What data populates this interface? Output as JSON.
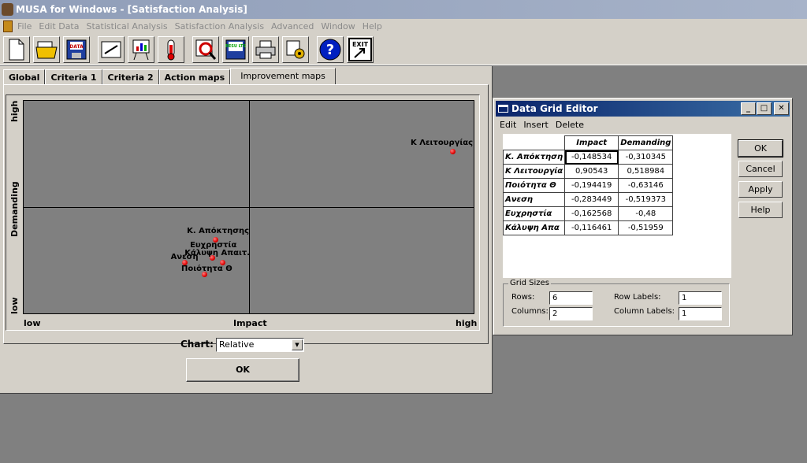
{
  "app": {
    "title": "MUSA for Windows - [Satisfaction Analysis]"
  },
  "menu": [
    "File",
    "Edit Data",
    "Statistical Analysis",
    "Satisfaction Analysis",
    "Advanced",
    "Window",
    "Help"
  ],
  "toolbar": {
    "data_label": "DATA",
    "results_label": "RESU LTS",
    "exit_label": "EXIT"
  },
  "tabs": [
    "Global",
    "Criteria 1",
    "Criteria 2",
    "Action maps",
    "Improvement maps"
  ],
  "chart": {
    "ylabel": "Demanding",
    "y_low": "low",
    "y_high": "high",
    "xlabel": "Impact",
    "x_low": "low",
    "x_high": "high",
    "label_select": "Chart:",
    "selected": "Relative",
    "ok": "OK"
  },
  "chart_data": {
    "type": "scatter",
    "xlabel": "Impact",
    "ylabel": "Demanding",
    "points": [
      {
        "label": "Κ. Απόκτησης",
        "x": -0.148534,
        "y": -0.310345
      },
      {
        "label": "Κ Λειτουργίας",
        "x": 0.90543,
        "y": 0.518984
      },
      {
        "label": "Ποιότητα Θ",
        "x": -0.194419,
        "y": -0.63146
      },
      {
        "label": "Ανεση",
        "x": -0.283449,
        "y": -0.519373
      },
      {
        "label": "Ευχρηστία",
        "x": -0.162568,
        "y": -0.48
      },
      {
        "label": "Κάλυψη Απαιτ.",
        "x": -0.116461,
        "y": -0.51959
      }
    ],
    "grid": false
  },
  "editor": {
    "title": "Data Grid Editor",
    "menu": [
      "Edit",
      "Insert",
      "Delete"
    ],
    "columns": [
      "Impact",
      "Demanding"
    ],
    "rows": [
      {
        "label": "Κ. Απόκτηση",
        "impact": "-0,148534",
        "demanding": "-0,310345"
      },
      {
        "label": "Κ Λειτουργία",
        "impact": "0,90543",
        "demanding": "0,518984"
      },
      {
        "label": "Ποιότητα Θ",
        "impact": "-0,194419",
        "demanding": "-0,63146"
      },
      {
        "label": "Ανεση",
        "impact": "-0,283449",
        "demanding": "-0,519373"
      },
      {
        "label": "Ευχρηστία",
        "impact": "-0,162568",
        "demanding": "-0,48"
      },
      {
        "label": "Κάλυψη Απα",
        "impact": "-0,116461",
        "demanding": "-0,51959"
      }
    ],
    "buttons": [
      "OK",
      "Cancel",
      "Apply",
      "Help"
    ],
    "grid_sizes": {
      "legend": "Grid Sizes",
      "rows_label": "Rows:",
      "rows": "6",
      "columns_label": "Columns:",
      "columns": "2",
      "row_labels_label": "Row Labels:",
      "row_labels": "1",
      "column_labels_label": "Column Labels:",
      "column_labels": "1"
    }
  }
}
